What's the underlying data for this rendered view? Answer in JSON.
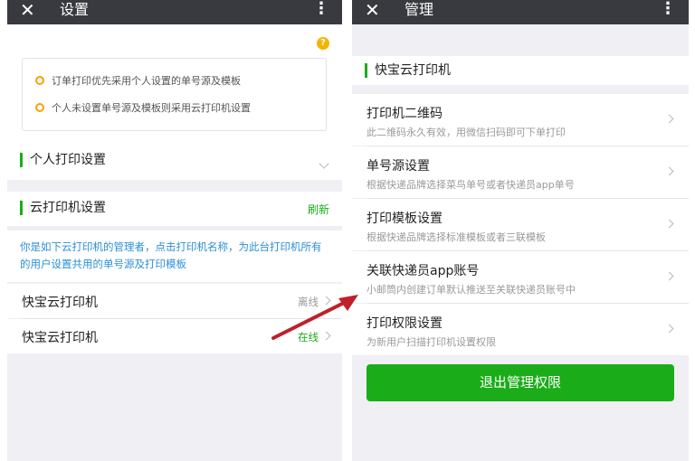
{
  "left": {
    "title": "设置",
    "close_icon": "close-icon",
    "more_icon": "more-vertical-icon",
    "help_icon_text": "?",
    "notices": [
      "订单打印优先采用个人设置的单号源及模板",
      "个人未设置单号源及模板则采用云打印机设置"
    ],
    "personal_section": "个人打印设置",
    "cloud_section": "云打印机设置",
    "refresh_label": "刷新",
    "admin_note": "你是如下云打印机的管理者，点击打印机名称，为此台打印机所有的用户设置共用的单号源及打印模板",
    "printers": [
      {
        "name": "快宝云打印机",
        "status": "离线",
        "status_color": "#999999"
      },
      {
        "name": "快宝云打印机",
        "status": "在线",
        "status_color": "#1aad19"
      }
    ]
  },
  "right": {
    "title": "管理",
    "close_icon": "close-icon",
    "more_icon": "more-vertical-icon",
    "section": "快宝云打印机",
    "menu": [
      {
        "title": "打印机二维码",
        "subtitle": "此二维码永久有效，用微信扫码即可下单打印"
      },
      {
        "title": "单号源设置",
        "subtitle": "根据快递品牌选择菜鸟单号或者快递员app单号"
      },
      {
        "title": "打印模板设置",
        "subtitle": "根据快递品牌选择标准模板或者三联模板"
      },
      {
        "title": "关联快递员app账号",
        "subtitle": "小邮筒内创建订单默认推送至关联快递员账号中"
      },
      {
        "title": "打印权限设置",
        "subtitle": "为新用户扫描打印机设置权限"
      }
    ],
    "exit_button": "退出管理权限"
  },
  "colors": {
    "accent_green": "#1aad19",
    "topbar": "#393a3f",
    "link_blue": "#2d8fd5",
    "arrow_red": "#c0202a",
    "notice_orange": "#f5a300"
  }
}
